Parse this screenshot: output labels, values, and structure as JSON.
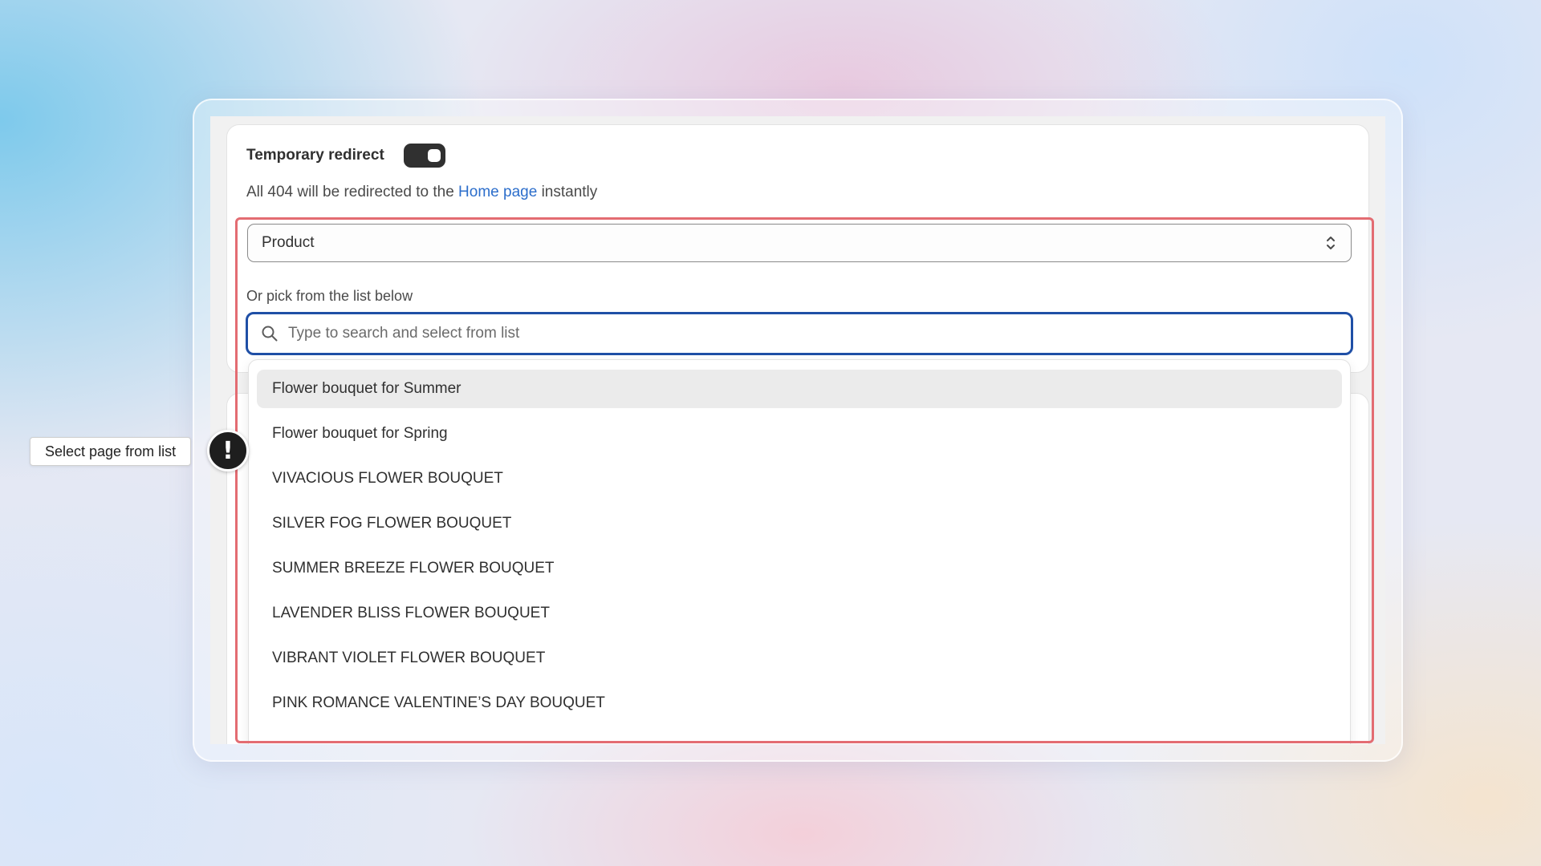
{
  "settings": {
    "title": "Temporary redirect",
    "toggle_on": true,
    "description_prefix": "All 404 will be redirected to the",
    "description_link": "Home page",
    "description_suffix": "instantly"
  },
  "type_select": {
    "value": "Product"
  },
  "list_picker": {
    "label": "Or pick from the list below",
    "search_placeholder": "Type to search and select from list",
    "search_value": "",
    "options": [
      "Flower bouquet for Summer",
      "Flower bouquet for Spring",
      "VIVACIOUS FLOWER BOUQUET",
      "SILVER FOG FLOWER BOUQUET",
      "SUMMER BREEZE FLOWER BOUQUET",
      "LAVENDER BLISS FLOWER BOUQUET",
      "VIBRANT VIOLET FLOWER BOUQUET",
      "PINK ROMANCE VALENTINE’S DAY BOUQUET"
    ],
    "active_index": 0
  },
  "annotation": {
    "tooltip": "Select page from list",
    "icon": "exclamation-icon",
    "highlight_color": "#e36c72"
  },
  "colors": {
    "toggle": "#303030",
    "link": "#2c6ecb",
    "focus": "#1f4fa6"
  }
}
